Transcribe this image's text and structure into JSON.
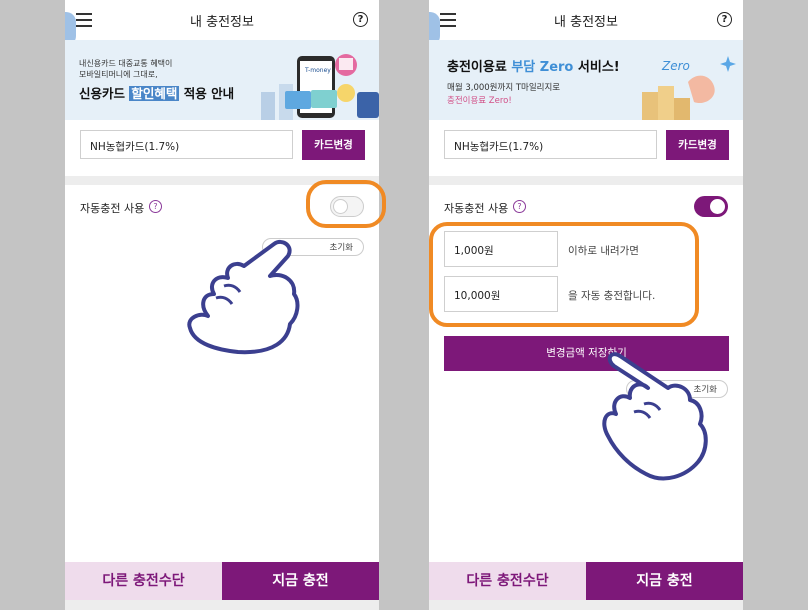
{
  "header": {
    "title": "내 충전정보",
    "help_symbol": "?"
  },
  "left_banner": {
    "line1": "내신용카드 대중교통 혜택이",
    "line2": "모바일티머니에 그대로,",
    "title_pre": "신용카드 ",
    "title_highlight": "할인혜택",
    "title_post": " 적용 안내",
    "card_brand": "T-money"
  },
  "right_banner": {
    "title_pre": "충전이용료 ",
    "title_accent": "부담 Zero",
    "title_post": " 서비스!",
    "sub1": "매월 3,000원까지 T마일리지로",
    "sub2": "충전이용료 Zero!",
    "badge": "Zero"
  },
  "card": {
    "name": "NH농협카드(1.7%)",
    "change_label": "카드변경"
  },
  "auto_charge": {
    "label": "자동충전 사용",
    "left_enabled": false,
    "right_enabled": true,
    "reset_label": "초기화",
    "threshold": "1,000원",
    "threshold_text": "이하로 내려가면",
    "charge_amount": "10,000원",
    "charge_text": "을 자동 충전합니다.",
    "save_label": "변경금액 저장하기"
  },
  "bottom": {
    "other_label": "다른 충전수단",
    "now_label": "지금 충전"
  },
  "colors": {
    "brand": "#7d1879",
    "highlight_ring": "#f08a24",
    "banner_accent": "#3f8fd6"
  }
}
